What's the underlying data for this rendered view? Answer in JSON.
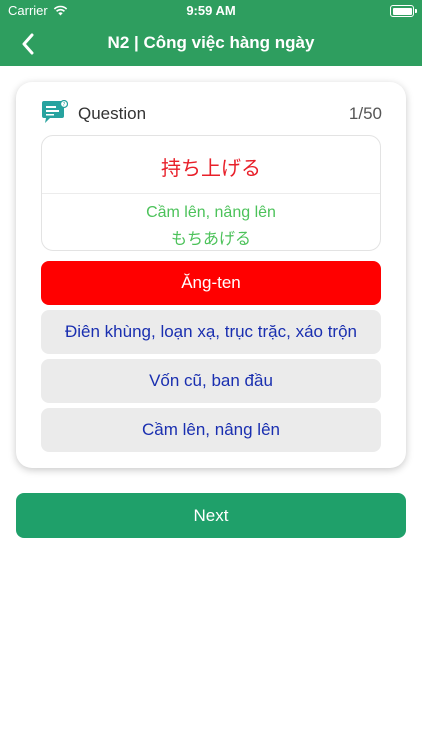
{
  "status_bar": {
    "carrier": "Carrier",
    "time": "9:59 AM"
  },
  "nav": {
    "title": "N2 | Công việc hàng ngày"
  },
  "question": {
    "label": "Question",
    "counter": "1/50",
    "term": "持ち上げる",
    "meaning": "Cầm lên, nâng lên",
    "reading": "もちあげる"
  },
  "options": [
    {
      "label": "Ăng-ten",
      "state": "wrong"
    },
    {
      "label": "Điên khùng, loạn xạ, trục trặc, xáo trộn",
      "state": "default"
    },
    {
      "label": "Vốn cũ, ban đầu",
      "state": "default"
    },
    {
      "label": "Cầm lên, nâng lên",
      "state": "default"
    }
  ],
  "next_label": "Next",
  "colors": {
    "primary": "#2e9e5f",
    "button": "#1fa06a",
    "wrong": "#ff0000",
    "option_text": "#1a2fb0",
    "term": "#e8202a",
    "meaning": "#4cc25a"
  },
  "icons": {
    "back": "chevron-left-icon",
    "question": "chat-bubble-icon",
    "wifi": "wifi-icon",
    "battery": "battery-icon"
  }
}
